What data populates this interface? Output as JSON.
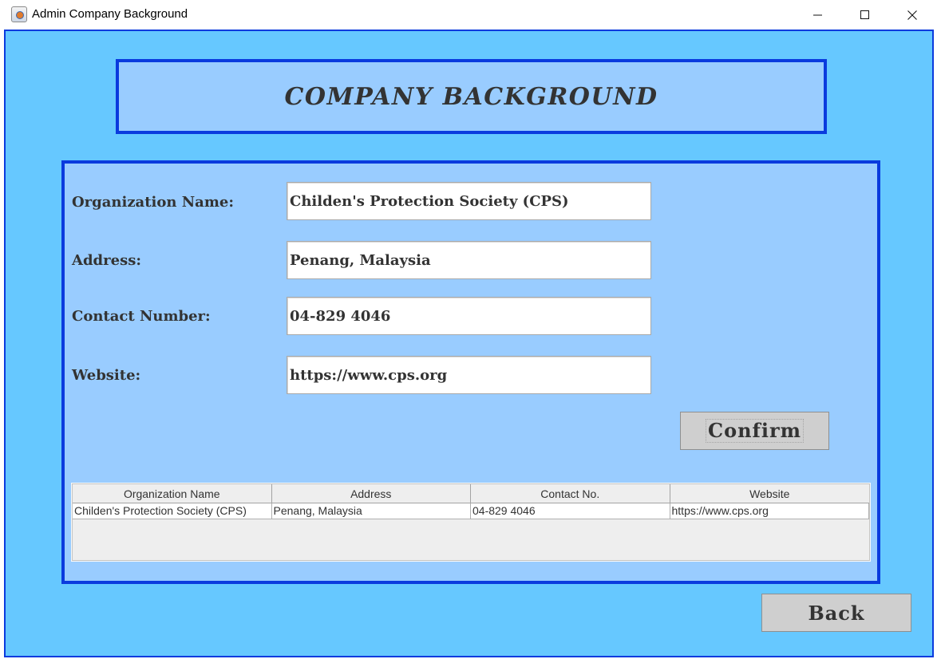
{
  "window": {
    "title": "Admin Company Background",
    "icon": "java-icon",
    "controls": [
      "minimize-icon",
      "maximize-icon",
      "close-icon"
    ]
  },
  "heading": "COMPANY BACKGROUND",
  "form": {
    "org_label": "Organization Name:",
    "org_value": "Childen's Protection Society (CPS)",
    "address_label": "Address:",
    "address_value": "Penang, Malaysia",
    "contact_label": "Contact Number:",
    "contact_value": "04-829 4046",
    "website_label": "Website:",
    "website_value": "https://www.cps.org",
    "confirm_label": "Confirm"
  },
  "table": {
    "columns": [
      "Organization Name",
      "Address",
      "Contact No.",
      "Website"
    ],
    "rows": [
      [
        "Childen's Protection Society (CPS)",
        "Penang, Malaysia",
        "04-829 4046",
        "https://www.cps.org"
      ]
    ]
  },
  "back_label": "Back",
  "colors": {
    "frame_bg": "#66c8ff",
    "panel_bg": "#99ccff",
    "border": "#0a3bde",
    "button_bg": "#cfcfcf",
    "text": "#333333"
  }
}
